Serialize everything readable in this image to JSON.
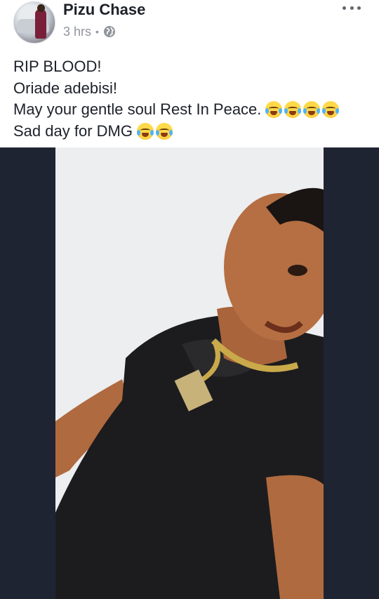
{
  "post": {
    "author": "Pizu Chase",
    "time": "3 hrs",
    "separator": "•",
    "privacy_icon": "globe-icon",
    "more_icon": "more-options-icon",
    "lines": [
      "RIP BLOOD!",
      "Oriade adebisi!",
      "May your gentle soul Rest In Peace.",
      "Sad day for DMG"
    ],
    "line3_emoji_count": 4,
    "line4_emoji_count": 2,
    "emoji_icon": "crying-laughing-emoji"
  },
  "photo": {
    "description_icon": "photo-of-man-in-black-shirt"
  },
  "colors": {
    "text": "#1d2129",
    "meta": "#90949c",
    "photo_border": "#1f2433"
  }
}
